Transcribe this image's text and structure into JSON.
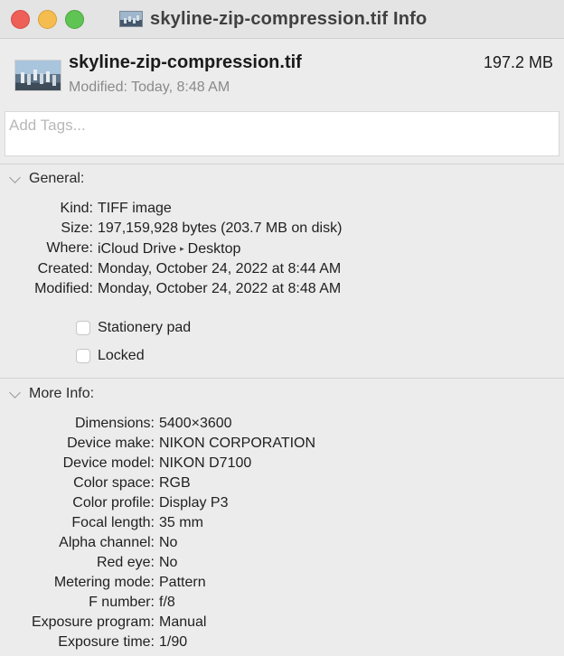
{
  "window": {
    "title": "skyline-zip-compression.tif Info"
  },
  "header": {
    "file_name": "skyline-zip-compression.tif",
    "file_size": "197.2 MB",
    "modified": "Modified: Today, 8:48 AM",
    "thumbnail_icon": "skyline-photo-thumbnail"
  },
  "tags": {
    "placeholder": "Add Tags..."
  },
  "general": {
    "heading": "General:",
    "rows": [
      {
        "key": "Kind:",
        "value": "TIFF image"
      },
      {
        "key": "Size:",
        "value": "197,159,928 bytes (203.7 MB on disk)"
      },
      {
        "key": "Where:",
        "value_parts": [
          "iCloud Drive",
          "Desktop"
        ]
      },
      {
        "key": "Created:",
        "value": "Monday, October 24, 2022 at 8:44 AM"
      },
      {
        "key": "Modified:",
        "value": "Monday, October 24, 2022 at 8:48 AM"
      }
    ],
    "checkboxes": [
      {
        "label": "Stationery pad",
        "checked": false
      },
      {
        "label": "Locked",
        "checked": false
      }
    ]
  },
  "more_info": {
    "heading": "More Info:",
    "rows": [
      {
        "key": "Dimensions:",
        "value": "5400×3600"
      },
      {
        "key": "Device make:",
        "value": "NIKON CORPORATION"
      },
      {
        "key": "Device model:",
        "value": "NIKON D7100"
      },
      {
        "key": "Color space:",
        "value": "RGB"
      },
      {
        "key": "Color profile:",
        "value": "Display P3"
      },
      {
        "key": "Focal length:",
        "value": "35 mm"
      },
      {
        "key": "Alpha channel:",
        "value": "No"
      },
      {
        "key": "Red eye:",
        "value": "No"
      },
      {
        "key": "Metering mode:",
        "value": "Pattern"
      },
      {
        "key": "F number:",
        "value": "f/8"
      },
      {
        "key": "Exposure program:",
        "value": "Manual"
      },
      {
        "key": "Exposure time:",
        "value": "1/90"
      }
    ]
  },
  "colors": {
    "close": "#ee5f58",
    "minimize": "#f5bd4f",
    "maximize": "#5fc454",
    "background": "#ececec"
  }
}
